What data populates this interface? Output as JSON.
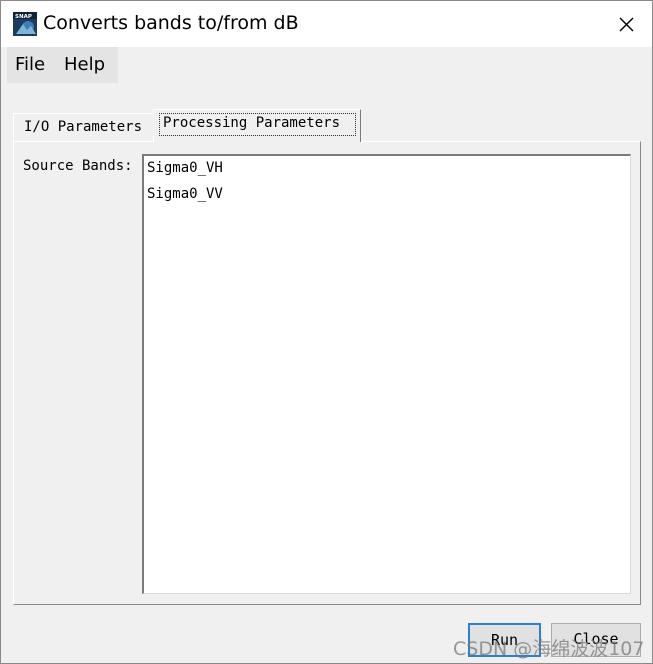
{
  "window": {
    "title": "Converts bands to/from dB",
    "icon": "snap-app-icon",
    "close_icon": "close-icon"
  },
  "menu": {
    "items": [
      {
        "label": "File"
      },
      {
        "label": "Help"
      }
    ]
  },
  "tabs": [
    {
      "label": "I/O Parameters",
      "selected": false
    },
    {
      "label": "Processing Parameters",
      "selected": true
    }
  ],
  "panel": {
    "source_bands_label": "Source Bands:",
    "source_bands": [
      "Sigma0_VH",
      "Sigma0_VV"
    ]
  },
  "buttons": {
    "run_label": "Run",
    "close_label": "Close"
  },
  "watermark": "CSDN @海绵波波107"
}
